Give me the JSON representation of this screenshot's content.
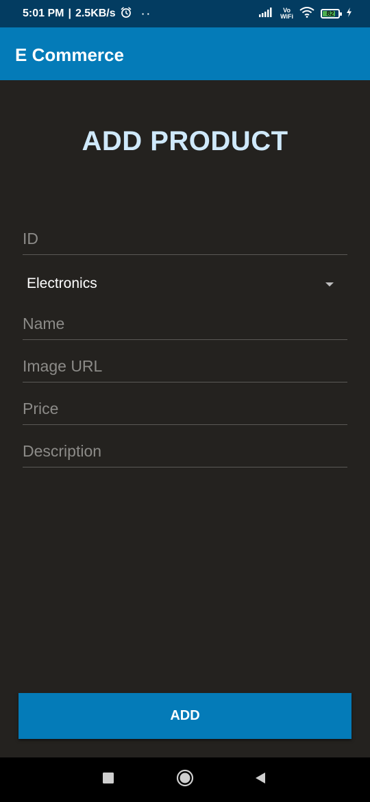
{
  "status_bar": {
    "time": "5:01 PM",
    "separator": "|",
    "speed": "2.5KB/s",
    "dots": "··",
    "vo": "Vo",
    "wifi_label": "WiFi",
    "battery": "82",
    "battery_level": 0.82
  },
  "app_bar": {
    "title": "E Commerce"
  },
  "form": {
    "heading": "ADD PRODUCT",
    "id_placeholder": "ID",
    "category_value": "Electronics",
    "name_placeholder": "Name",
    "image_url_placeholder": "Image URL",
    "price_placeholder": "Price",
    "description_placeholder": "Description",
    "submit_label": "ADD"
  },
  "colors": {
    "status_bar": "#033c61",
    "app_bar": "#047bb8",
    "background": "#24221f",
    "heading": "#cfe9fb",
    "button": "#047bb8"
  },
  "icons": {
    "alarm": "alarm-icon",
    "signal": "signal-icon",
    "wifi": "wifi-icon",
    "battery": "battery-icon",
    "charging": "charging-icon",
    "dropdown": "dropdown-arrow-icon",
    "recents": "recents-icon",
    "home": "home-icon",
    "back": "back-icon"
  }
}
